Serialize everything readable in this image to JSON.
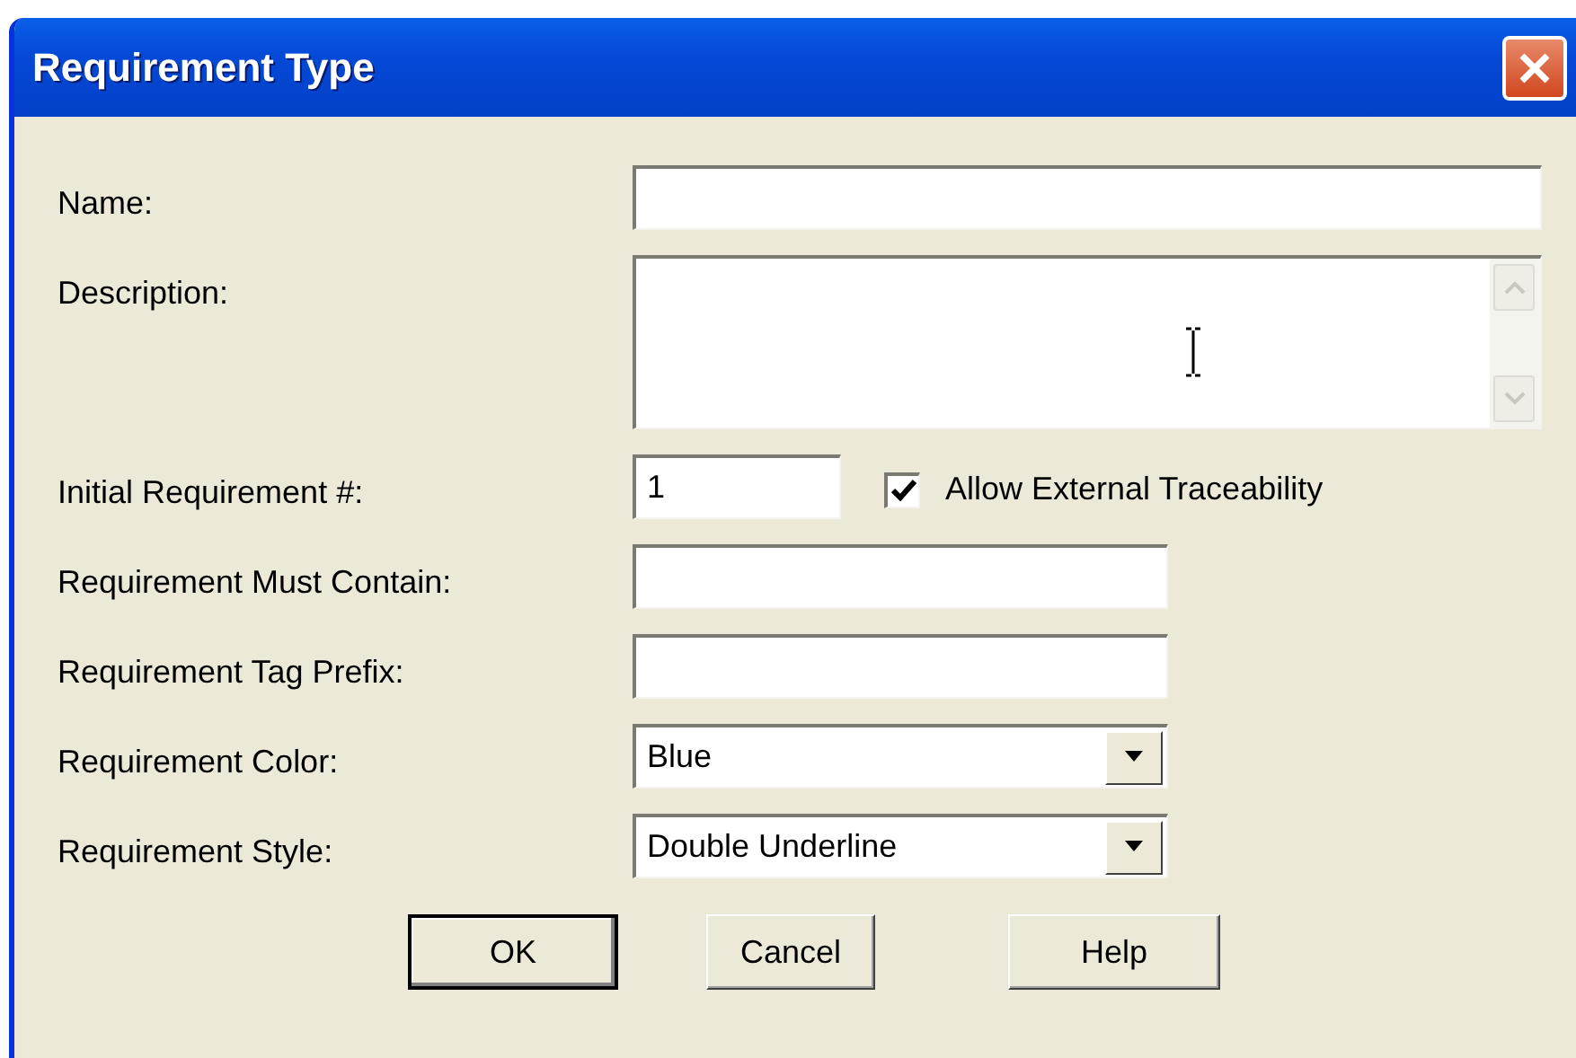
{
  "window": {
    "title": "Requirement Type"
  },
  "fields": [
    {
      "kind": "wide-text",
      "label": "Name:"
    },
    {
      "kind": "textarea",
      "label": "Description:"
    },
    {
      "kind": "number-with-checkbox",
      "label": "Initial Requirement #:",
      "value": "1",
      "checkbox": {
        "label": "Allow External Traceability",
        "checked": true
      }
    },
    {
      "kind": "text",
      "label": "Requirement Must Contain:"
    },
    {
      "kind": "text",
      "label": "Requirement Tag Prefix:"
    },
    {
      "kind": "select",
      "label": "Requirement Color:",
      "value": "Blue"
    },
    {
      "kind": "select",
      "label": "Requirement Style:",
      "value": "Double Underline"
    }
  ],
  "buttons": [
    {
      "label": "OK",
      "default": true
    },
    {
      "label": "Cancel",
      "default": false
    },
    {
      "label": "Help",
      "default": false
    }
  ]
}
